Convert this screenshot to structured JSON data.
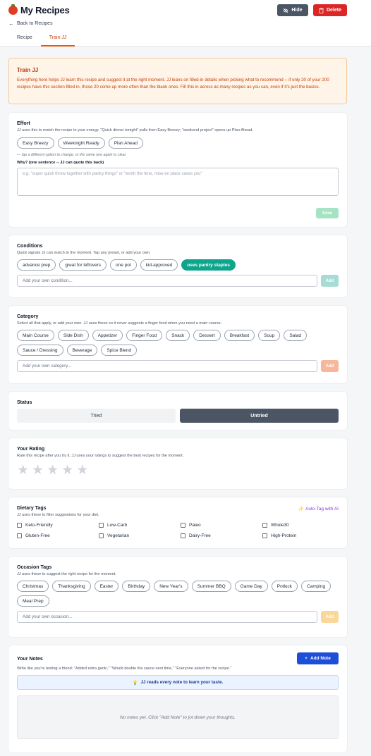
{
  "header": {
    "title": "My Recipes",
    "back_label": "Back to Recipes",
    "hide_label": "Hide",
    "delete_label": "Delete",
    "tabs": [
      {
        "label": "Recipe",
        "active": false
      },
      {
        "label": "Train JJ",
        "active": true
      }
    ]
  },
  "banner": {
    "title": "Train JJ",
    "text": "Everything here helps JJ learn this recipe and suggest it at the right moment. JJ leans on filled-in details when picking what to recommend -- if only 20 of your 200 recipes have this section filled in, those 20 come up more often than the blank ones. Fill this in across as many recipes as you can, even if it's just the basics."
  },
  "effort": {
    "title": "Effort",
    "subtitle": "JJ uses this to match the recipe to your energy. \"Quick dinner tonight\" pulls from Easy Breezy; \"weekend project\" opens up Plan Ahead.",
    "options": [
      "Easy Breezy",
      "Weeknight Ready",
      "Plan Ahead"
    ],
    "hint": "— tap a different option to change, or the same one again to clear.",
    "why_label": "Why? (one sentence -- JJ can quote this back)",
    "why_placeholder": "e.g. \"super quick throw together with pantry things\" or \"worth the time, mise en place saves you\"",
    "save_label": "Save"
  },
  "conditions": {
    "title": "Conditions",
    "subtitle": "Quick signals JJ can match to the moment. Tap any preset, or add your own.",
    "chips": [
      {
        "label": "advance prep",
        "selected": false
      },
      {
        "label": "great for leftovers",
        "selected": false
      },
      {
        "label": "one pot",
        "selected": false
      },
      {
        "label": "kid-approved",
        "selected": false
      },
      {
        "label": "uses pantry staples",
        "selected": true
      }
    ],
    "input_placeholder": "Add your own condition...",
    "add_label": "Add",
    "add_color": "#a7dcd4"
  },
  "category": {
    "title": "Category",
    "subtitle": "Select all that apply, or add your own. JJ uses these so it never suggests a finger food when you need a main course.",
    "chips": [
      "Main Course",
      "Side Dish",
      "Appetizer",
      "Finger Food",
      "Snack",
      "Dessert",
      "Breakfast",
      "Soup",
      "Salad",
      "Sauce / Dressing",
      "Beverage",
      "Spice Blend"
    ],
    "input_placeholder": "Add your own category...",
    "add_label": "Add",
    "add_color": "#f6b79a"
  },
  "status": {
    "title": "Status",
    "options": [
      {
        "label": "Tried",
        "active": false
      },
      {
        "label": "Untried",
        "active": true
      }
    ]
  },
  "rating": {
    "title": "Your Rating",
    "subtitle": "Rate this recipe after you try it. JJ uses your ratings to suggest the best recipes for the moment.",
    "value": 0,
    "max": 5
  },
  "dietary": {
    "title": "Dietary Tags",
    "subtitle": "JJ uses these to filter suggestions for your diet.",
    "auto_tag_label": "Auto-Tag with AI",
    "items": [
      "Keto-Friendly",
      "Low-Carb",
      "Paleo",
      "Whole30",
      "Gluten-Free",
      "Vegetarian",
      "Dairy-Free",
      "High-Protein"
    ]
  },
  "occasion": {
    "title": "Occasion Tags",
    "subtitle": "JJ uses these to suggest the right recipe for the moment.",
    "chips": [
      "Christmas",
      "Thanksgiving",
      "Easter",
      "Birthday",
      "New Year's",
      "Summer BBQ",
      "Game Day",
      "Potluck",
      "Camping",
      "Meal Prep"
    ],
    "input_placeholder": "Add your own occasion...",
    "add_label": "Add",
    "add_color": "#fcd79a"
  },
  "notes": {
    "title": "Your Notes",
    "subtitle": "Write like you're texting a friend: \"Added extra garlic,\" \"Would double the sauce next time,\" \"Everyone asked for the recipe.\"",
    "add_note_label": "Add Note",
    "info_text": "JJ reads every note to learn your taste.",
    "empty_text": "No notes yet. Click \"Add Note\" to jot down your thoughts."
  }
}
